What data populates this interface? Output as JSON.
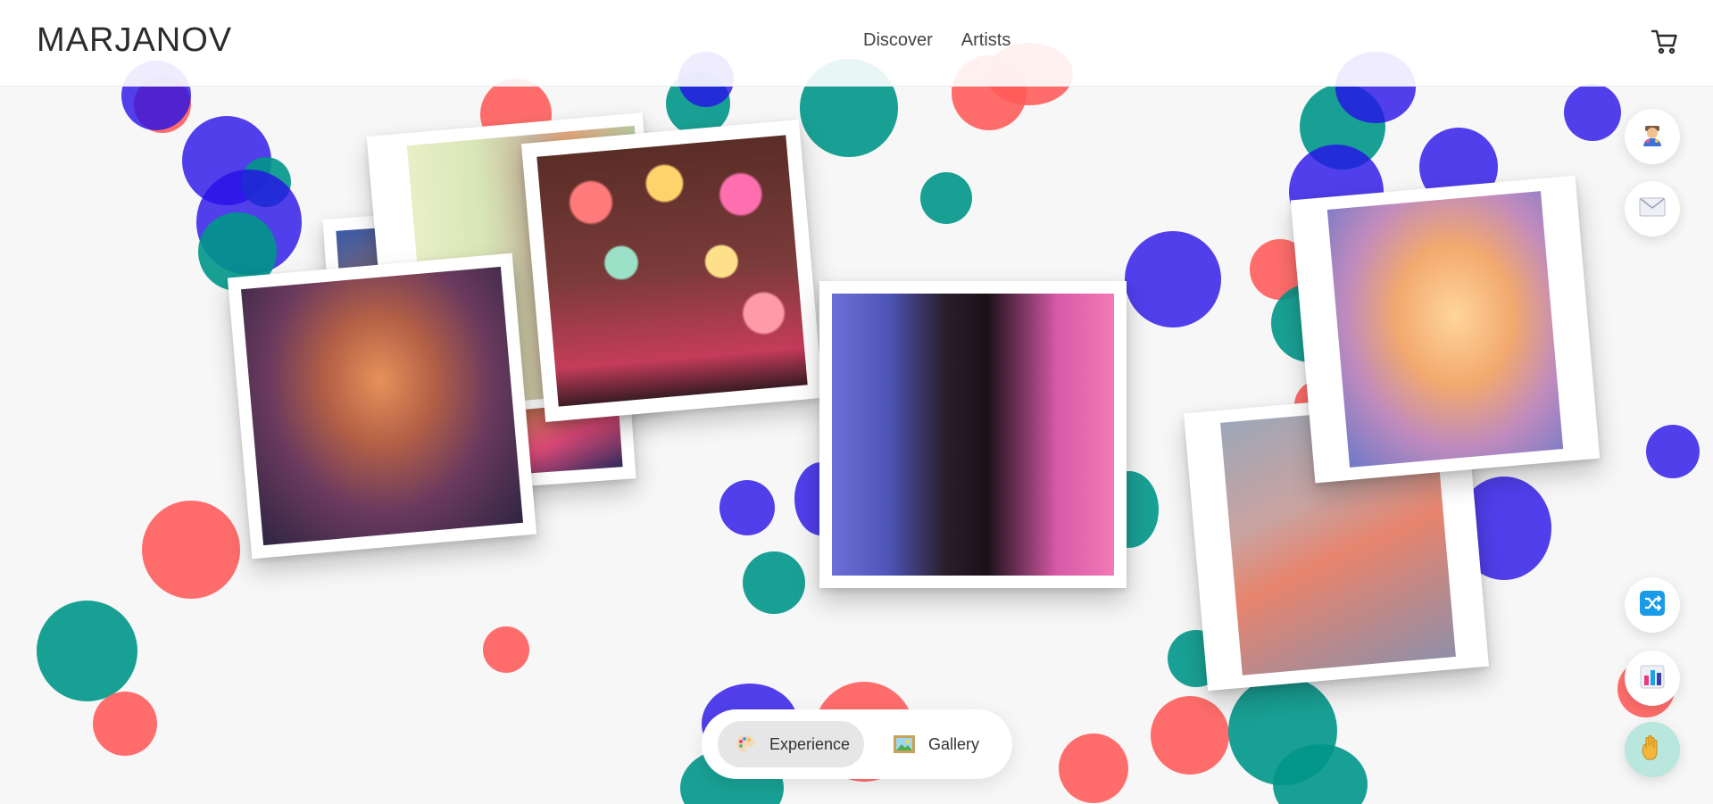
{
  "header": {
    "logo": "MARJANOV",
    "nav": [
      {
        "label": "Discover"
      },
      {
        "label": "Artists"
      }
    ]
  },
  "view_modes": {
    "active": "Experience",
    "items": [
      {
        "label": "Experience"
      },
      {
        "label": "Gallery"
      }
    ]
  },
  "side_actions": {
    "top": [
      "artist-emoji-icon",
      "envelope-icon"
    ],
    "bottom": [
      "shuffle-icon",
      "bar-chart-icon",
      "raised-hand-icon"
    ]
  },
  "colors": {
    "blue": "#2510e7",
    "teal": "#009688",
    "coral": "#ff5a58",
    "background": "#f7f7f7"
  }
}
